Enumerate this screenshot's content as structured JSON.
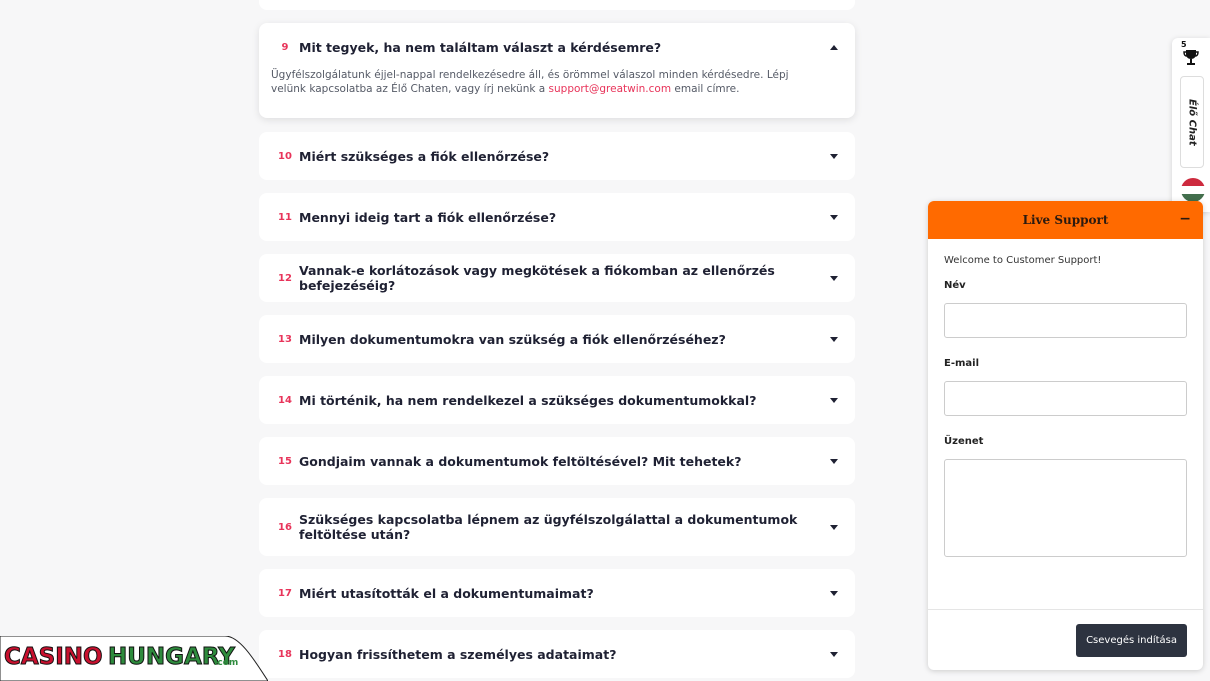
{
  "faq": {
    "items": [
      {
        "num": "9",
        "question": "Mit tegyek, ha nem találtam választ a kérdésemre?",
        "open": true,
        "answer_before": "Ügyfélszolgálatunk éjjel-nappal rendelkezésedre áll, és örömmel válaszol minden kérdésedre. Lépj velünk kapcsolatba az Élő Chaten, vagy írj nekünk a ",
        "answer_link": "support@greatwin.com",
        "answer_after": " email címre."
      },
      {
        "num": "10",
        "question": "Miért szükséges a fiók ellenőrzése?"
      },
      {
        "num": "11",
        "question": "Mennyi ideig tart a fiók ellenőrzése?"
      },
      {
        "num": "12",
        "question": "Vannak-e korlátozások vagy megkötések a fiókomban az ellenőrzés befejezéséig?"
      },
      {
        "num": "13",
        "question": "Milyen dokumentumokra van szükség a fiók ellenőrzéséhez?"
      },
      {
        "num": "14",
        "question": "Mi történik, ha nem rendelkezel a szükséges dokumentumokkal?"
      },
      {
        "num": "15",
        "question": "Gondjaim vannak a dokumentumok feltöltésével? Mit tehetek?"
      },
      {
        "num": "16",
        "question": "Szükséges kapcsolatba lépnem az ügyfélszolgálattal a dokumentumok feltöltése után?"
      },
      {
        "num": "17",
        "question": "Miért utasították el a dokumentumaimat?"
      },
      {
        "num": "18",
        "question": "Hogyan frissíthetem a személyes adataimat?"
      }
    ]
  },
  "sidebar": {
    "trophy_count": "5",
    "trophy_icon": "trophy-icon",
    "live_chat_label": "Élő Chat",
    "flag_icon": "hungary-flag-icon",
    "flag_colors": [
      "#cd2a3e",
      "#ffffff",
      "#436f4d"
    ]
  },
  "support": {
    "title": "Live Support",
    "minimize_label": "−",
    "welcome": "Welcome to Customer Support!",
    "name_label": "Név",
    "email_label": "E-mail",
    "message_label": "Üzenet",
    "start_button": "Csevegés indítása",
    "accent_color": "#ff6a00"
  },
  "logo": {
    "text": "CASINO HUNGARY.com"
  }
}
